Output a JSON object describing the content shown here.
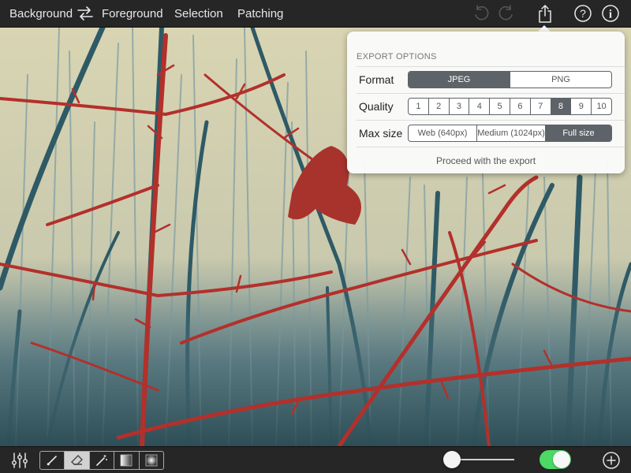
{
  "app": {
    "nav": {
      "background": "Background",
      "foreground": "Foreground",
      "selection": "Selection",
      "patching": "Patching"
    },
    "icons": {
      "swap": "swap-arrows-icon",
      "undo": "undo-icon",
      "redo": "redo-icon",
      "share": "share-export-icon",
      "help": "help-icon",
      "info": "info-icon"
    }
  },
  "export_popover": {
    "title": "EXPORT OPTIONS",
    "format": {
      "label": "Format",
      "options": [
        "JPEG",
        "PNG"
      ],
      "selected": "JPEG"
    },
    "quality": {
      "label": "Quality",
      "options": [
        "1",
        "2",
        "3",
        "4",
        "5",
        "6",
        "7",
        "8",
        "9",
        "10"
      ],
      "selected": "8"
    },
    "max_size": {
      "label": "Max size",
      "options": [
        "Web (640px)",
        "Medium (1024px)",
        "Full size"
      ],
      "selected": "Full size"
    },
    "proceed_label": "Proceed with the export"
  },
  "toolbar": {
    "tools": [
      "brush-icon",
      "eraser-icon",
      "magic-wand-icon",
      "linear-gradient-icon",
      "radial-gradient-icon"
    ],
    "selected_tool": "eraser-icon",
    "settings_icon": "sliders-icon",
    "add_icon": "add-icon",
    "slider_level": 0,
    "toggle_on": true
  },
  "colors": {
    "bar_bg": "#262626",
    "segment_selected": "#5d6368",
    "toggle_on": "#4cd964",
    "photo_sky": "#d8d4b0",
    "branch_red": "#b8302a",
    "tree_teal": "#2f5f6b"
  }
}
